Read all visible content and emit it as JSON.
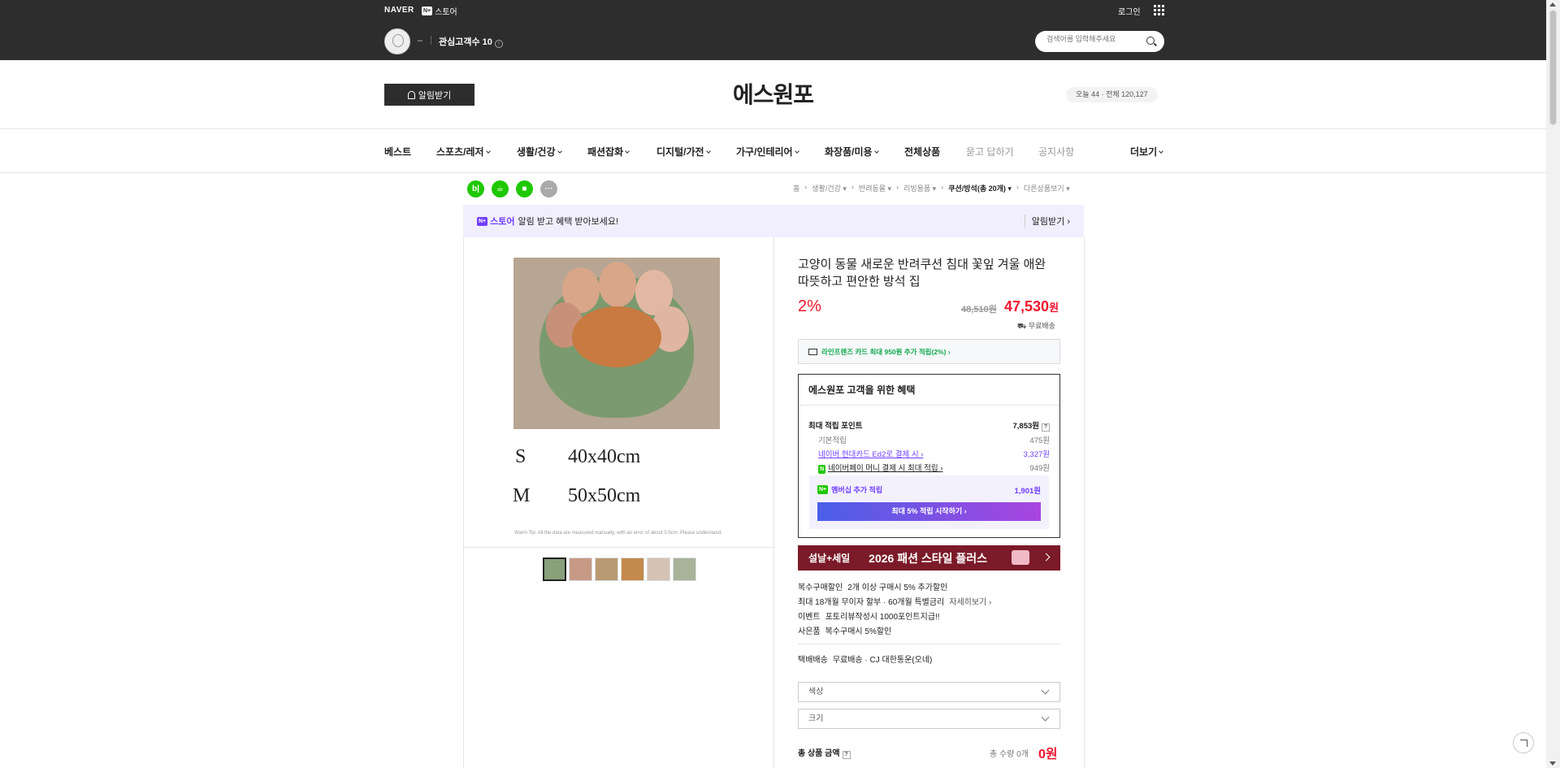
{
  "topbar": {
    "naver": "NAVER",
    "store_badge": "N+",
    "store_label": "스토어",
    "login": "로그인",
    "dash": "–",
    "followers": "관심고객수 10",
    "search_placeholder": "검색어를 입력해주세요"
  },
  "header": {
    "alarm_button": "알림받기",
    "store_name": "에스원포",
    "visitors": "오늘 44 · 전체 120,127"
  },
  "nav": [
    {
      "label": "베스트",
      "dropdown": false,
      "light": false
    },
    {
      "label": "스포츠/레저",
      "dropdown": true,
      "light": false
    },
    {
      "label": "생활/건강",
      "dropdown": true,
      "light": false
    },
    {
      "label": "패션잡화",
      "dropdown": true,
      "light": false
    },
    {
      "label": "디지털/가전",
      "dropdown": true,
      "light": false
    },
    {
      "label": "가구/인테리어",
      "dropdown": true,
      "light": false
    },
    {
      "label": "화장품/미용",
      "dropdown": true,
      "light": false
    },
    {
      "label": "전체상품",
      "dropdown": false,
      "light": false
    },
    {
      "label": "묻고 답하기",
      "dropdown": false,
      "light": true
    },
    {
      "label": "공지사항",
      "dropdown": false,
      "light": true
    },
    {
      "label": "더보기",
      "dropdown": true,
      "light": false
    }
  ],
  "share_icons": [
    {
      "name": "blog-share-icon",
      "glyph": "b|",
      "color": "#1ec800"
    },
    {
      "name": "cafe-share-icon",
      "glyph": "☕",
      "color": "#1ec800"
    },
    {
      "name": "bookmark-icon",
      "glyph": "■",
      "color": "#1ec800"
    },
    {
      "name": "more-icon",
      "glyph": "···",
      "color": "#aaaaaa"
    }
  ],
  "breadcrumb": [
    "홈",
    "생활/건강 ▾",
    "반려동물 ▾",
    "리빙용품 ▾",
    "쿠션/방석(총 20개) ▾",
    "다른상품보기 ▾"
  ],
  "promo": {
    "badge": "N+",
    "store": "스토어",
    "message": "알림 받고 혜택 받아보세요!",
    "right": "알림받기 ›"
  },
  "image": {
    "size_s": "S",
    "size_s_val": "40x40cm",
    "size_m": "M",
    "size_m_val": "50x50cm",
    "warn": "Warm Tip: All the data are measured manually, with an error of about 0.5cm. Please understand.",
    "thumb_colors": [
      "#8aa07a",
      "#c79a86",
      "#b89b73",
      "#c48a4c",
      "#d4c3b4",
      "#a8b39a"
    ]
  },
  "product": {
    "title": "고양이 동물 새로운 반려쿠션 침대 꽃잎 겨울 애완 따뜻하고 편안한 방석 집",
    "discount": "2%",
    "original_price": "48,510원",
    "price": "47,530",
    "price_unit": "원",
    "shipping": "무료배송",
    "card_benefit": "라인프렌즈 카드 최대 950원 추가 적립(2%) ›"
  },
  "benefit": {
    "title": "에스원포 고객을 위한 혜택",
    "max_point_label": "최대 적립 포인트",
    "max_point_value": "7,853원",
    "basic_label": "기본적립",
    "basic_value": "475원",
    "hyundai_label": "네이버 현대카드 Ed2로 결제 시 ›",
    "hyundai_value": "3,327원",
    "npay_label": "네이버페이 머니 결제 시 최대 적립 ›",
    "npay_value": "949원",
    "member_label": "멤버십 추가 적립",
    "member_value": "1,901원",
    "member_button": "최대 5% 적립 시작하기 ›"
  },
  "banner": {
    "a": "설날+세일",
    "b": "2026 패션 스타일 플러스"
  },
  "info": [
    {
      "k": "복수구매할인",
      "v": "2개 이상 구매시 5% 추가할인",
      "link": ""
    },
    {
      "k": "최대 18개월 무이자 할부 · 60개월 특별금리",
      "v": "",
      "link": "자세히보기 ›"
    },
    {
      "k": "이벤트",
      "v": "포토리뷰작성시 1000포인트지급!!",
      "link": ""
    },
    {
      "k": "사은품",
      "v": "복수구매시 5%할인",
      "link": ""
    }
  ],
  "delivery": {
    "k": "택배배송",
    "v": "무료배송 · CJ 대한통운(오네)"
  },
  "options": {
    "color": "색상",
    "size": "크기"
  },
  "total": {
    "label": "총 상품 금액",
    "qty": "총 수량 0개",
    "value": "0원"
  }
}
